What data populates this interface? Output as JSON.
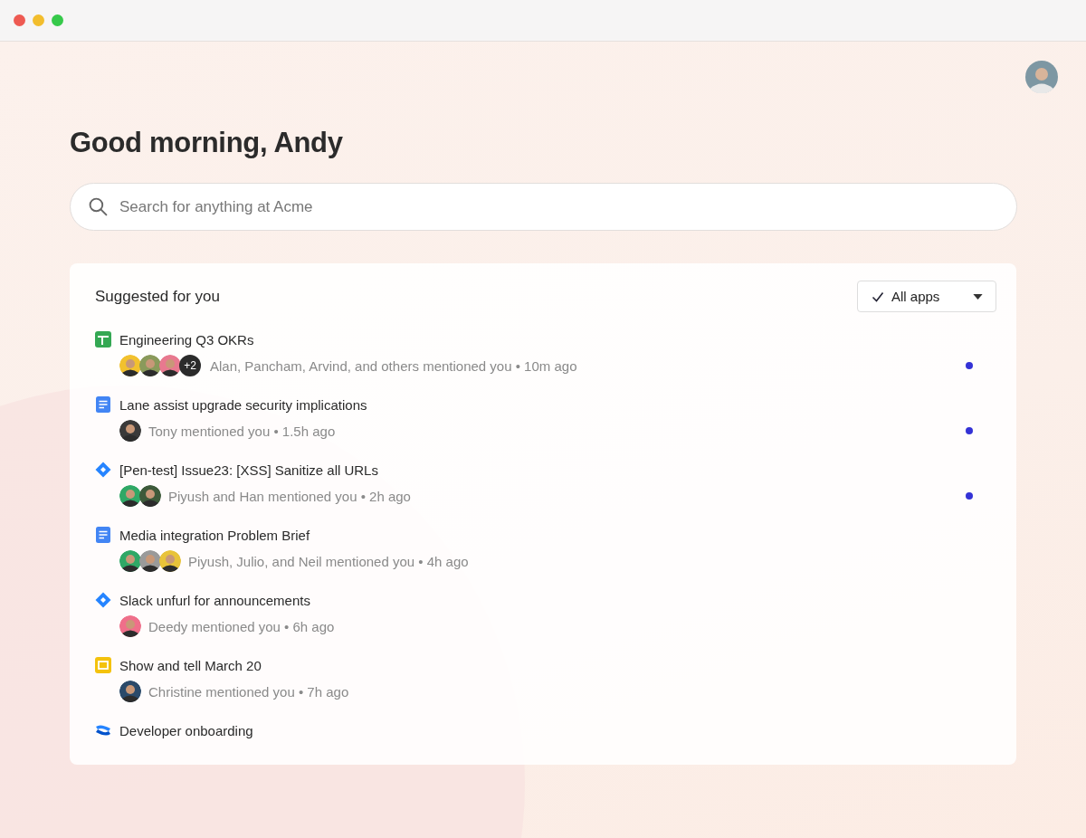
{
  "greeting": "Good morning, Andy",
  "search": {
    "placeholder": "Search for anything at Acme"
  },
  "suggestions": {
    "title": "Suggested for you",
    "filter": {
      "label": "All apps",
      "checked": true
    },
    "items": [
      {
        "kind": "sheet",
        "title": "Engineering Q3 OKRs",
        "avatars": [
          {
            "color": "#f2c12e"
          },
          {
            "color": "#8a9a5b"
          },
          {
            "color": "#e8798f"
          }
        ],
        "overflow": "+2",
        "meta": "Alan, Pancham, Arvind, and others mentioned you • 10m ago",
        "unread": true
      },
      {
        "kind": "doc",
        "title": "Lane assist upgrade security implications",
        "avatars": [
          {
            "color": "#3a3a3a"
          }
        ],
        "meta": "Tony mentioned you • 1.5h ago",
        "unread": true
      },
      {
        "kind": "jira",
        "title": "[Pen-test] Issue23: [XSS] Sanitize all URLs",
        "avatars": [
          {
            "color": "#2fa866"
          },
          {
            "color": "#3d5a3a"
          }
        ],
        "meta": "Piyush and Han mentioned you • 2h ago",
        "unread": true
      },
      {
        "kind": "doc",
        "title": "Media integration Problem Brief",
        "avatars": [
          {
            "color": "#2fa866"
          },
          {
            "color": "#9a9a9a"
          },
          {
            "color": "#e8c33a"
          }
        ],
        "meta": "Piyush, Julio, and Neil mentioned you • 4h ago",
        "unread": false
      },
      {
        "kind": "jira",
        "title": "Slack unfurl for announcements",
        "avatars": [
          {
            "color": "#ef6f8a"
          }
        ],
        "meta": "Deedy mentioned you • 6h ago",
        "unread": false
      },
      {
        "kind": "slides",
        "title": "Show and tell March 20",
        "avatars": [
          {
            "color": "#2a4a6a"
          }
        ],
        "meta": "Christine mentioned you • 7h ago",
        "unread": false
      },
      {
        "kind": "confluence",
        "title": "Developer onboarding",
        "unread": false
      }
    ]
  }
}
